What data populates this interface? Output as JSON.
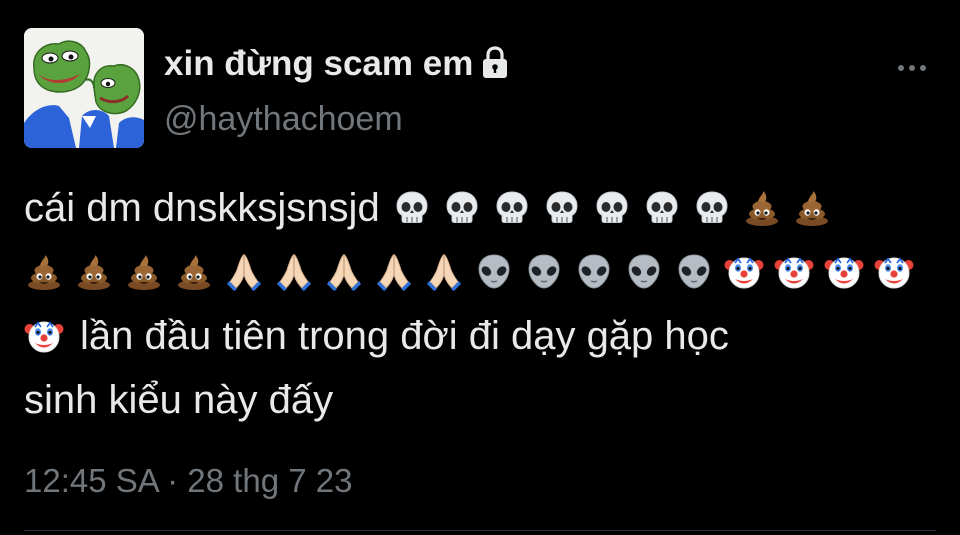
{
  "author": {
    "display_name": "xin đừng scam em",
    "handle": "@haythachoem",
    "protected_icon": "lock-icon",
    "avatar_icon": "pepe-frog-avatar"
  },
  "tweet": {
    "text_line1": "cái dm dnskksjsnsjd",
    "line1_emojis": [
      "skull",
      "skull",
      "skull",
      "skull",
      "skull",
      "skull",
      "skull",
      "poop",
      "poop"
    ],
    "line2_emojis": [
      "poop",
      "poop",
      "poop",
      "poop",
      "folded-hands",
      "folded-hands",
      "folded-hands",
      "folded-hands",
      "folded-hands",
      "alien",
      "alien",
      "alien",
      "alien",
      "alien",
      "clown",
      "clown",
      "clown",
      "clown"
    ],
    "line3_leading_emoji": "clown",
    "text_line3": "lần đầu tiên trong đời đi dạy gặp học",
    "text_line4": "sinh kiểu này đấy"
  },
  "meta": {
    "time": "12:45 SA",
    "separator": "·",
    "date": "28 thg 7 23"
  },
  "colors": {
    "background": "#000000",
    "primary_text": "#e7e9ea",
    "secondary_text": "#71767b"
  },
  "menu": {
    "more_icon": "more-icon"
  }
}
